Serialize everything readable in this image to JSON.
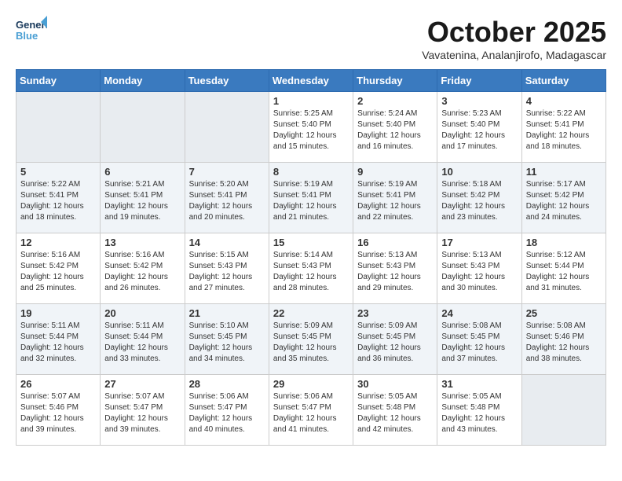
{
  "logo": {
    "line1": "General",
    "line2": "Blue"
  },
  "title": "October 2025",
  "subtitle": "Vavatenina, Analanjirofo, Madagascar",
  "days_of_week": [
    "Sunday",
    "Monday",
    "Tuesday",
    "Wednesday",
    "Thursday",
    "Friday",
    "Saturday"
  ],
  "weeks": [
    [
      {
        "day": "",
        "info": ""
      },
      {
        "day": "",
        "info": ""
      },
      {
        "day": "",
        "info": ""
      },
      {
        "day": "1",
        "info": "Sunrise: 5:25 AM\nSunset: 5:40 PM\nDaylight: 12 hours\nand 15 minutes."
      },
      {
        "day": "2",
        "info": "Sunrise: 5:24 AM\nSunset: 5:40 PM\nDaylight: 12 hours\nand 16 minutes."
      },
      {
        "day": "3",
        "info": "Sunrise: 5:23 AM\nSunset: 5:40 PM\nDaylight: 12 hours\nand 17 minutes."
      },
      {
        "day": "4",
        "info": "Sunrise: 5:22 AM\nSunset: 5:41 PM\nDaylight: 12 hours\nand 18 minutes."
      }
    ],
    [
      {
        "day": "5",
        "info": "Sunrise: 5:22 AM\nSunset: 5:41 PM\nDaylight: 12 hours\nand 18 minutes."
      },
      {
        "day": "6",
        "info": "Sunrise: 5:21 AM\nSunset: 5:41 PM\nDaylight: 12 hours\nand 19 minutes."
      },
      {
        "day": "7",
        "info": "Sunrise: 5:20 AM\nSunset: 5:41 PM\nDaylight: 12 hours\nand 20 minutes."
      },
      {
        "day": "8",
        "info": "Sunrise: 5:19 AM\nSunset: 5:41 PM\nDaylight: 12 hours\nand 21 minutes."
      },
      {
        "day": "9",
        "info": "Sunrise: 5:19 AM\nSunset: 5:41 PM\nDaylight: 12 hours\nand 22 minutes."
      },
      {
        "day": "10",
        "info": "Sunrise: 5:18 AM\nSunset: 5:42 PM\nDaylight: 12 hours\nand 23 minutes."
      },
      {
        "day": "11",
        "info": "Sunrise: 5:17 AM\nSunset: 5:42 PM\nDaylight: 12 hours\nand 24 minutes."
      }
    ],
    [
      {
        "day": "12",
        "info": "Sunrise: 5:16 AM\nSunset: 5:42 PM\nDaylight: 12 hours\nand 25 minutes."
      },
      {
        "day": "13",
        "info": "Sunrise: 5:16 AM\nSunset: 5:42 PM\nDaylight: 12 hours\nand 26 minutes."
      },
      {
        "day": "14",
        "info": "Sunrise: 5:15 AM\nSunset: 5:43 PM\nDaylight: 12 hours\nand 27 minutes."
      },
      {
        "day": "15",
        "info": "Sunrise: 5:14 AM\nSunset: 5:43 PM\nDaylight: 12 hours\nand 28 minutes."
      },
      {
        "day": "16",
        "info": "Sunrise: 5:13 AM\nSunset: 5:43 PM\nDaylight: 12 hours\nand 29 minutes."
      },
      {
        "day": "17",
        "info": "Sunrise: 5:13 AM\nSunset: 5:43 PM\nDaylight: 12 hours\nand 30 minutes."
      },
      {
        "day": "18",
        "info": "Sunrise: 5:12 AM\nSunset: 5:44 PM\nDaylight: 12 hours\nand 31 minutes."
      }
    ],
    [
      {
        "day": "19",
        "info": "Sunrise: 5:11 AM\nSunset: 5:44 PM\nDaylight: 12 hours\nand 32 minutes."
      },
      {
        "day": "20",
        "info": "Sunrise: 5:11 AM\nSunset: 5:44 PM\nDaylight: 12 hours\nand 33 minutes."
      },
      {
        "day": "21",
        "info": "Sunrise: 5:10 AM\nSunset: 5:45 PM\nDaylight: 12 hours\nand 34 minutes."
      },
      {
        "day": "22",
        "info": "Sunrise: 5:09 AM\nSunset: 5:45 PM\nDaylight: 12 hours\nand 35 minutes."
      },
      {
        "day": "23",
        "info": "Sunrise: 5:09 AM\nSunset: 5:45 PM\nDaylight: 12 hours\nand 36 minutes."
      },
      {
        "day": "24",
        "info": "Sunrise: 5:08 AM\nSunset: 5:45 PM\nDaylight: 12 hours\nand 37 minutes."
      },
      {
        "day": "25",
        "info": "Sunrise: 5:08 AM\nSunset: 5:46 PM\nDaylight: 12 hours\nand 38 minutes."
      }
    ],
    [
      {
        "day": "26",
        "info": "Sunrise: 5:07 AM\nSunset: 5:46 PM\nDaylight: 12 hours\nand 39 minutes."
      },
      {
        "day": "27",
        "info": "Sunrise: 5:07 AM\nSunset: 5:47 PM\nDaylight: 12 hours\nand 39 minutes."
      },
      {
        "day": "28",
        "info": "Sunrise: 5:06 AM\nSunset: 5:47 PM\nDaylight: 12 hours\nand 40 minutes."
      },
      {
        "day": "29",
        "info": "Sunrise: 5:06 AM\nSunset: 5:47 PM\nDaylight: 12 hours\nand 41 minutes."
      },
      {
        "day": "30",
        "info": "Sunrise: 5:05 AM\nSunset: 5:48 PM\nDaylight: 12 hours\nand 42 minutes."
      },
      {
        "day": "31",
        "info": "Sunrise: 5:05 AM\nSunset: 5:48 PM\nDaylight: 12 hours\nand 43 minutes."
      },
      {
        "day": "",
        "info": ""
      }
    ]
  ]
}
